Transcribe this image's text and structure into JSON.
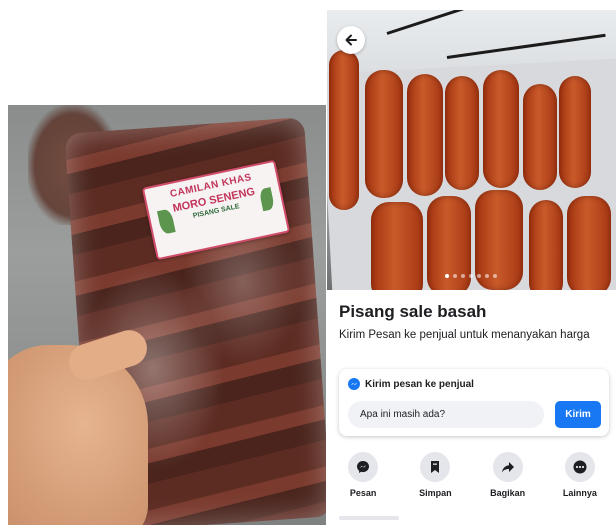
{
  "left_photo": {
    "label_line1": "CAMILAN KHAS",
    "label_line2": "MORO SENENG",
    "label_line3": "PISANG SALE"
  },
  "listing": {
    "title": "Pisang sale basah",
    "subtitle": "Kirim Pesan ke penjual untuk menanyakan harga",
    "carousel": {
      "count": 7,
      "active_index": 0
    }
  },
  "message_card": {
    "header": "Kirim pesan ke penjual",
    "input_value": "Apa ini masih ada?",
    "send_label": "Kirim",
    "icon": "messenger-icon"
  },
  "actions": [
    {
      "label": "Pesan",
      "icon": "messenger-icon"
    },
    {
      "label": "Simpan",
      "icon": "bookmark-icon"
    },
    {
      "label": "Bagikan",
      "icon": "share-icon"
    },
    {
      "label": "Lainnya",
      "icon": "more-icon"
    }
  ],
  "colors": {
    "accent": "#1877f2",
    "text": "#1c1e21",
    "icon_circle": "#e4e6eb"
  }
}
